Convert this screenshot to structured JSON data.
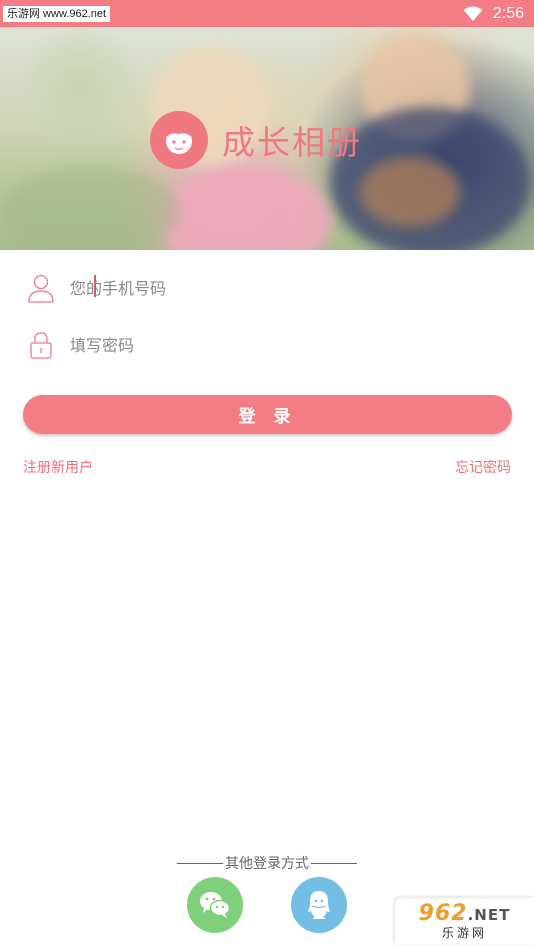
{
  "status_bar": {
    "watermark": "乐游网 www.962.net",
    "time": "2:56",
    "icons": [
      "wifi-icon"
    ]
  },
  "hero": {
    "app_title": "成长相册",
    "logo_icon": "child-face-logo-icon"
  },
  "login_form": {
    "phone_placeholder": "您的手机号码",
    "password_placeholder": "填写密码",
    "phone_icon": "user-icon",
    "password_icon": "lock-icon",
    "login_label": "登 录"
  },
  "links": {
    "register": "注册新用户",
    "forgot_password": "忘记密码"
  },
  "other_login": {
    "label": "其他登录方式",
    "methods": [
      {
        "name": "wechat",
        "icon": "wechat-icon",
        "color": "#7fd07b"
      },
      {
        "name": "qq",
        "icon": "qq-icon",
        "color": "#73bfe3"
      }
    ]
  },
  "corner_badge": {
    "top": "962",
    "top_suffix": ".NET",
    "bottom": "乐游网"
  },
  "colors": {
    "accent": "#f47c84",
    "link": "#ef6f79",
    "wechat": "#7fd07b",
    "qq": "#73bfe3"
  }
}
